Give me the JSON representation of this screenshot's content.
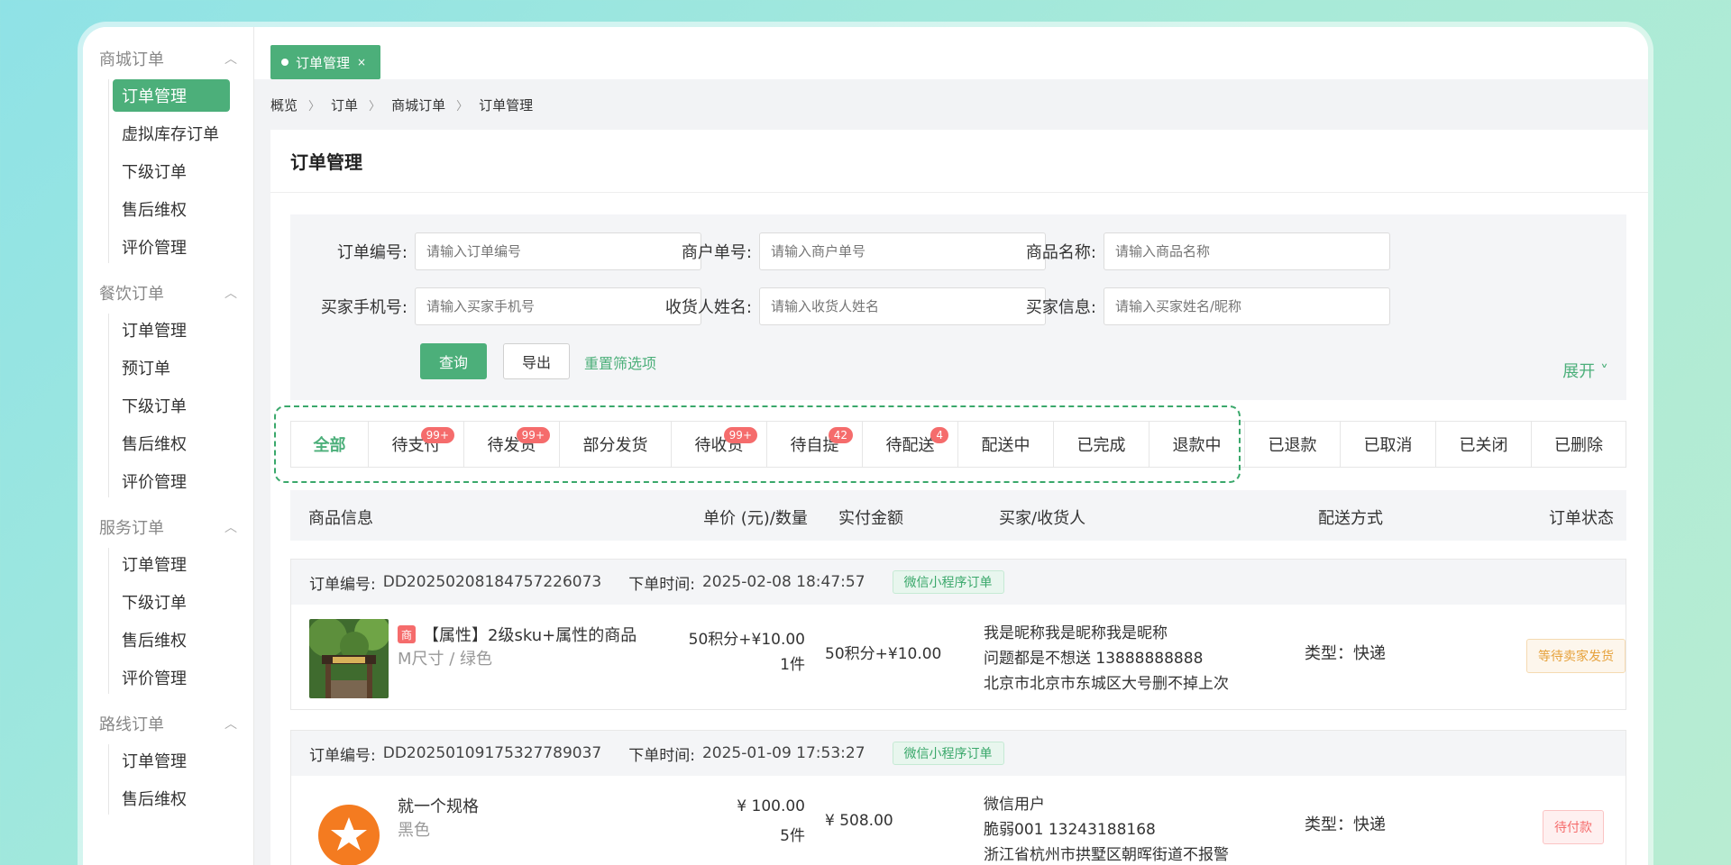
{
  "sidebar": {
    "groups": [
      {
        "title": "商城订单",
        "items": [
          "订单管理",
          "虚拟库存订单",
          "下级订单",
          "售后维权",
          "评价管理"
        ]
      },
      {
        "title": "餐饮订单",
        "items": [
          "订单管理",
          "预订单",
          "下级订单",
          "售后维权",
          "评价管理"
        ]
      },
      {
        "title": "服务订单",
        "items": [
          "订单管理",
          "下级订单",
          "售后维权",
          "评价管理"
        ]
      },
      {
        "title": "路线订单",
        "items": [
          "订单管理",
          "售后维权"
        ]
      }
    ]
  },
  "tab": {
    "label": "订单管理",
    "close": "×"
  },
  "breadcrumb": [
    "概览",
    "订单",
    "商城订单",
    "订单管理"
  ],
  "page_title": "订单管理",
  "filters": {
    "order_no": {
      "label": "订单编号:",
      "placeholder": "请输入订单编号"
    },
    "merchant_no": {
      "label": "商户单号:",
      "placeholder": "请输入商户单号"
    },
    "product_name": {
      "label": "商品名称:",
      "placeholder": "请输入商品名称"
    },
    "buyer_phone": {
      "label": "买家手机号:",
      "placeholder": "请输入买家手机号"
    },
    "receiver_name": {
      "label": "收货人姓名:",
      "placeholder": "请输入收货人姓名"
    },
    "buyer_info": {
      "label": "买家信息:",
      "placeholder": "请输入买家姓名/昵称"
    },
    "query": "查询",
    "export": "导出",
    "reset": "重置筛选项",
    "expand": "展开 ˅"
  },
  "status_tabs": [
    {
      "label": "全部",
      "badge": ""
    },
    {
      "label": "待支付",
      "badge": "99+"
    },
    {
      "label": "待发货",
      "badge": "99+"
    },
    {
      "label": "部分发货",
      "badge": ""
    },
    {
      "label": "待收货",
      "badge": "99+"
    },
    {
      "label": "待自提",
      "badge": "42"
    },
    {
      "label": "待配送",
      "badge": "4"
    },
    {
      "label": "配送中",
      "badge": ""
    },
    {
      "label": "已完成",
      "badge": ""
    },
    {
      "label": "退款中",
      "badge": ""
    },
    {
      "label": "已退款",
      "badge": ""
    },
    {
      "label": "已取消",
      "badge": ""
    },
    {
      "label": "已关闭",
      "badge": ""
    },
    {
      "label": "已删除",
      "badge": ""
    }
  ],
  "table_headers": {
    "product": "商品信息",
    "unit_price": "单价 (元)/数量",
    "paid": "实付金额",
    "buyer": "买家/收货人",
    "shipping": "配送方式",
    "status": "订单状态"
  },
  "orders": [
    {
      "no_label": "订单编号:",
      "no": "DD20250208184757226073",
      "time_label": "下单时间:",
      "time": "2025-02-08 18:47:57",
      "tag": "微信小程序订单",
      "product_icon": "商",
      "product_name": "【属性】2级sku+属性的商品",
      "spec": "M尺寸 / 绿色",
      "price": "50积分+¥10.00",
      "qty": "1件",
      "paid": "50积分+¥10.00",
      "buyer": [
        "我是昵称我是昵称我是昵称",
        "问题都是不想送 13888888888",
        "北京市北京市东城区大号删不掉上次"
      ],
      "shipping": "类型：快递",
      "status": "等待卖家发货"
    },
    {
      "no_label": "订单编号:",
      "no": "DD20250109175327789037",
      "time_label": "下单时间:",
      "time": "2025-01-09 17:53:27",
      "tag": "微信小程序订单",
      "product_name": "就一个规格",
      "spec": "黑色",
      "price": "¥ 100.00",
      "qty": "5件",
      "paid": "¥ 508.00",
      "buyer": [
        "微信用户",
        "脆弱001 13243188168",
        "浙江省杭州市拱墅区朝晖街道不报警"
      ],
      "shipping": "类型：快递",
      "status": "待付款"
    }
  ],
  "colors": {
    "accent": "#4caf7a",
    "badge": "#f56c6c"
  }
}
